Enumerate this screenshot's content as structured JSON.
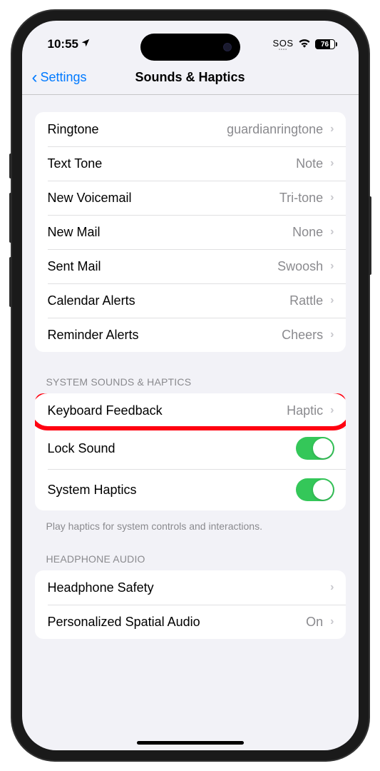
{
  "status": {
    "time": "10:55",
    "sos": "SOS",
    "battery": "76"
  },
  "nav": {
    "back": "Settings",
    "title": "Sounds & Haptics"
  },
  "sounds": [
    {
      "label": "Ringtone",
      "value": "guardianringtone"
    },
    {
      "label": "Text Tone",
      "value": "Note"
    },
    {
      "label": "New Voicemail",
      "value": "Tri-tone"
    },
    {
      "label": "New Mail",
      "value": "None"
    },
    {
      "label": "Sent Mail",
      "value": "Swoosh"
    },
    {
      "label": "Calendar Alerts",
      "value": "Rattle"
    },
    {
      "label": "Reminder Alerts",
      "value": "Cheers"
    }
  ],
  "sections": {
    "system": "SYSTEM SOUNDS & HAPTICS",
    "headphone": "HEADPHONE AUDIO"
  },
  "system": {
    "keyboard_label": "Keyboard Feedback",
    "keyboard_value": "Haptic",
    "lock_label": "Lock Sound",
    "haptics_label": "System Haptics",
    "footer": "Play haptics for system controls and interactions."
  },
  "headphone": {
    "safety_label": "Headphone Safety",
    "spatial_label": "Personalized Spatial Audio",
    "spatial_value": "On"
  }
}
